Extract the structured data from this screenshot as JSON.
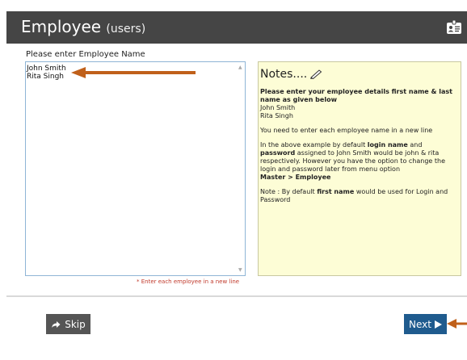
{
  "header": {
    "title": "Employee",
    "subtitle": "(users)"
  },
  "form": {
    "field_label": "Please enter Employee Name",
    "names_value": "John Smith\nRita Singh",
    "hint": "* Enter each employee in a new line"
  },
  "notes": {
    "title": "Notes....",
    "intro_bold": "Please enter your employee details first name & last name as given below",
    "example_1": "John Smith",
    "example_2": "Rita Singh",
    "line_instruction": "You need to enter each employee name in a new line",
    "para_part1": "In the above example by default ",
    "login_name": "login name",
    "para_and": " and ",
    "password": "password",
    "para_part2": " assigned to John Smith would be john & rita respectively. However you have the option to change the login and password later from menu option",
    "menu_path": "Master > Employee",
    "note_part1": "Note : By default ",
    "first_name": "first name",
    "note_part2": " would be used for Login and Password"
  },
  "buttons": {
    "skip": "Skip",
    "next": "Next"
  },
  "colors": {
    "header_bg": "#454545",
    "notes_bg": "#fdfdd6",
    "next_bg": "#1f5b8e",
    "skip_bg": "#555555",
    "annotation_arrow": "#c0601a",
    "hint_text": "#c0392b"
  },
  "icons": {
    "header": "id-card-icon",
    "notes": "pencil-icon",
    "skip": "share-arrow-icon",
    "next": "play-triangle-icon"
  }
}
